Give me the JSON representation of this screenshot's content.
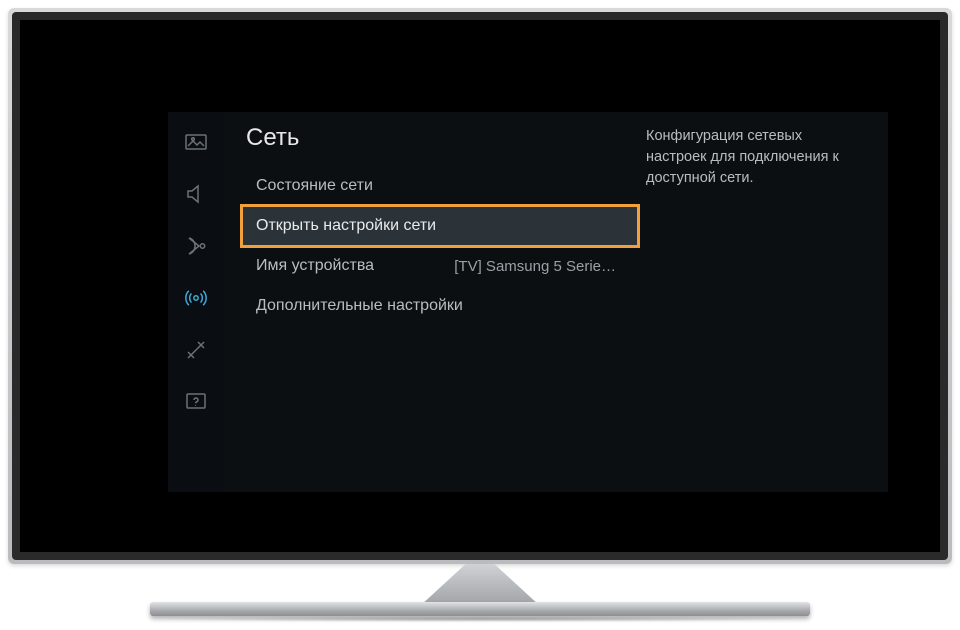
{
  "menu": {
    "title": "Сеть",
    "items": [
      {
        "label": "Состояние сети",
        "value": ""
      },
      {
        "label": "Открыть настройки сети",
        "value": ""
      },
      {
        "label": "Имя устройства",
        "value": "[TV] Samsung 5 Serie…"
      },
      {
        "label": "Дополнительные настройки",
        "value": ""
      }
    ]
  },
  "description": "Конфигурация сетевых настроек для подключения к доступной сети.",
  "sidebar": {
    "icons": [
      "picture-icon",
      "sound-icon",
      "broadcast-icon",
      "network-icon",
      "system-icon",
      "support-icon"
    ]
  }
}
